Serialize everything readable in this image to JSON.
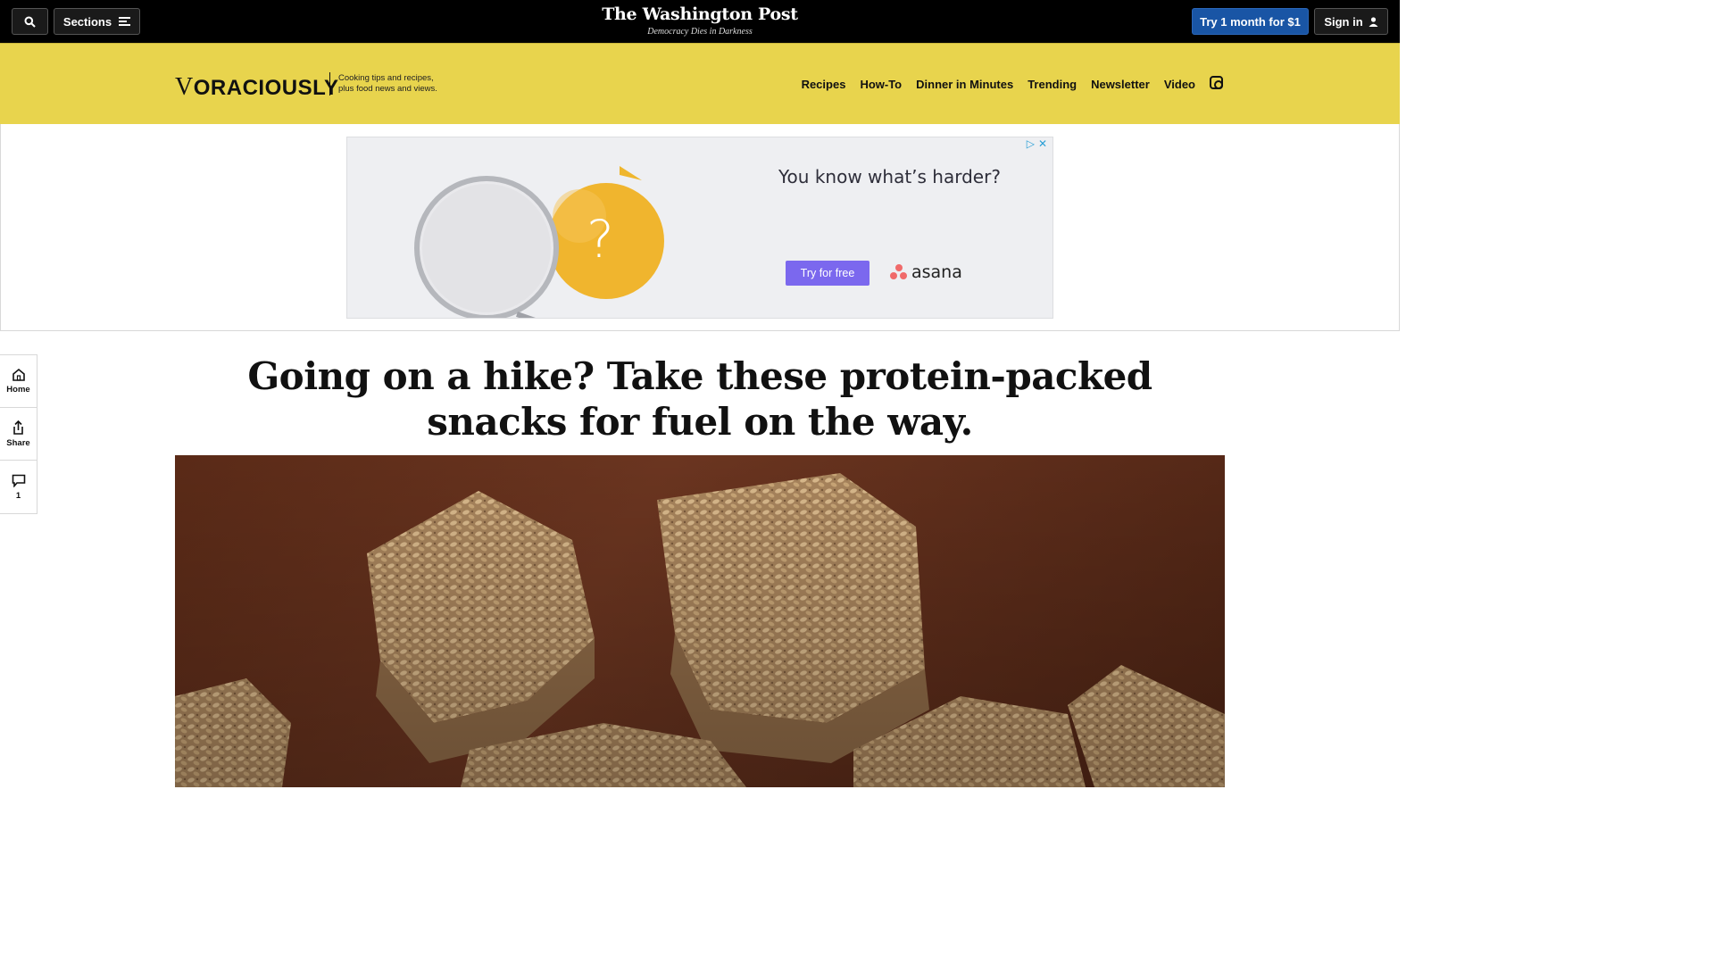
{
  "topbar": {
    "search_icon": "search-icon",
    "sections_label": "Sections",
    "logo": "The Washington Post",
    "tagline": "Democracy Dies in Darkness",
    "subscribe_label": "Try 1 month for $1",
    "signin_label": "Sign in"
  },
  "voraciously": {
    "logo_v": "V",
    "logo_rest": "ORACIOUSLY",
    "desc_line1": "Cooking tips and recipes,",
    "desc_line2": "plus food news and views.",
    "nav": [
      "Recipes",
      "How-To",
      "Dinner in Minutes",
      "Trending",
      "Newsletter",
      "Video"
    ],
    "social_icon": "instagram-icon",
    "band_color": "#e8d44d"
  },
  "ad": {
    "headline": "You know what’s harder?",
    "cta": "Try for free",
    "brand": "asana",
    "adchoices": "▷",
    "close": "✕",
    "question_mark": "?"
  },
  "rail": {
    "home_label": "Home",
    "share_label": "Share",
    "comments_count": "1"
  },
  "article": {
    "headline": "Going on a hike? Take these protein-packed snacks for fuel on the way."
  }
}
